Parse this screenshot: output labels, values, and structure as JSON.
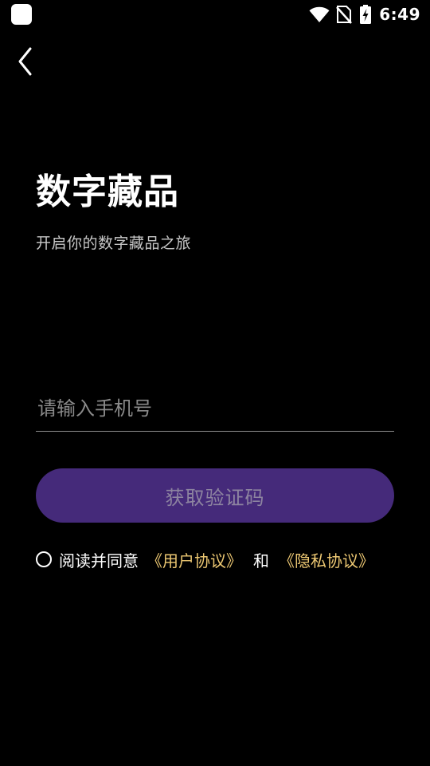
{
  "status_bar": {
    "time": "6:49",
    "icons": [
      "notification-icon",
      "wifi-icon",
      "no-sim-icon",
      "battery-charging-icon"
    ]
  },
  "nav": {
    "back_icon": "chevron-left-icon"
  },
  "header": {
    "title": "数字藏品",
    "subtitle": "开启你的数字藏品之旅"
  },
  "form": {
    "phone_placeholder": "请输入手机号",
    "phone_value": "",
    "get_code_label": "获取验证码"
  },
  "agreement": {
    "checked": false,
    "prefix": "阅读并同意",
    "user_agreement": "《用户协议》",
    "and": "和",
    "privacy_policy": "《隐私协议》"
  },
  "colors": {
    "background": "#000000",
    "button_bg": "#452a7a",
    "button_text": "#8d84a0",
    "link": "#ecc772",
    "placeholder": "#8a8a8a"
  }
}
